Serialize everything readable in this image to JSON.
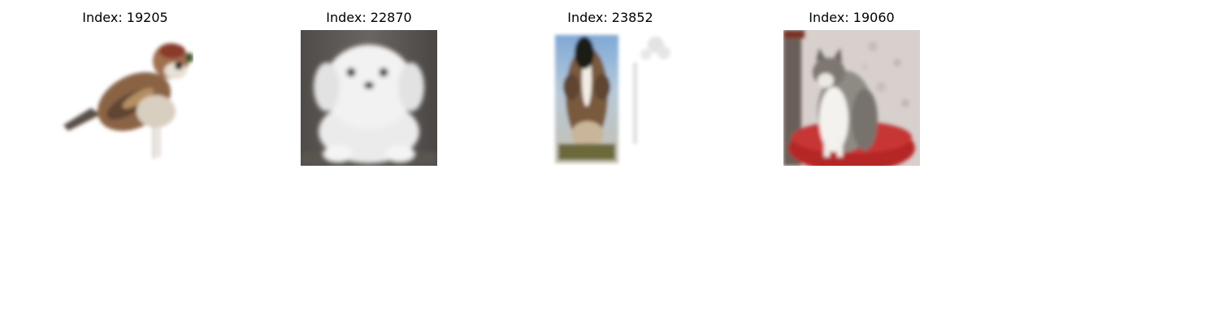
{
  "figure": {
    "panels": [
      {
        "title": "Index: 19205",
        "subject": "sparrow-bird"
      },
      {
        "title": "Index: 22870",
        "subject": "white-puppy"
      },
      {
        "title": "Index: 23852",
        "subject": "horse-photo-card"
      },
      {
        "title": "Index: 19060",
        "subject": "tabby-white-cat-on-red-cushion"
      }
    ]
  }
}
